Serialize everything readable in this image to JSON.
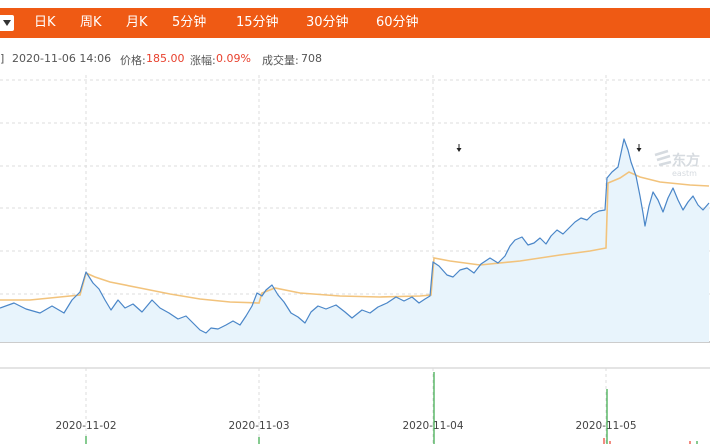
{
  "tabs": [
    "日K",
    "周K",
    "月K",
    "5分钟",
    "15分钟",
    "30分钟",
    "60分钟"
  ],
  "info": {
    "edge_mark": "]",
    "datetime": "2020-11-06 14:06",
    "price_label": "价格:",
    "price_value": "185.00",
    "change_label": "涨幅:",
    "change_value": "0.09%",
    "volume_label": "成交量:",
    "volume_value": "708"
  },
  "watermark": {
    "cn": "东方",
    "en": "eastm"
  },
  "colors": {
    "tabbar": "#ef5a14",
    "price_line": "#4a86c8",
    "avg_line": "#f2c37c",
    "area_fill": "#e8f4fc",
    "up_bar": "#e84030",
    "down_bar": "#35a845",
    "grid": "#dcdcdc"
  },
  "chart_data": {
    "type": "line",
    "x_tick_labels": [
      "2020-11-02",
      "2020-11-03",
      "2020-11-04",
      "2020-11-05"
    ],
    "grid": true,
    "series": [
      {
        "role": "price",
        "points": [
          [
            0,
            308
          ],
          [
            14,
            303
          ],
          [
            26,
            309
          ],
          [
            40,
            313
          ],
          [
            52,
            306
          ],
          [
            64,
            313
          ],
          [
            72,
            300
          ],
          [
            80,
            292
          ],
          [
            86,
            272
          ],
          [
            93,
            283
          ],
          [
            99,
            289
          ],
          [
            105,
            300
          ],
          [
            111,
            310
          ],
          [
            118,
            300
          ],
          [
            125,
            308
          ],
          [
            133,
            304
          ],
          [
            142,
            312
          ],
          [
            152,
            300
          ],
          [
            160,
            308
          ],
          [
            169,
            313
          ],
          [
            178,
            319
          ],
          [
            186,
            316
          ],
          [
            193,
            323
          ],
          [
            200,
            330
          ],
          [
            206,
            333
          ],
          [
            211,
            328
          ],
          [
            218,
            329
          ],
          [
            226,
            325
          ],
          [
            233,
            321
          ],
          [
            240,
            325
          ],
          [
            246,
            316
          ],
          [
            252,
            306
          ],
          [
            257,
            293
          ],
          [
            262,
            296
          ],
          [
            266,
            290
          ],
          [
            272,
            285
          ],
          [
            278,
            295
          ],
          [
            284,
            302
          ],
          [
            291,
            313
          ],
          [
            298,
            317
          ],
          [
            305,
            323
          ],
          [
            311,
            312
          ],
          [
            318,
            306
          ],
          [
            326,
            309
          ],
          [
            336,
            305
          ],
          [
            345,
            312
          ],
          [
            352,
            318
          ],
          [
            362,
            310
          ],
          [
            370,
            313
          ],
          [
            378,
            307
          ],
          [
            387,
            303
          ],
          [
            396,
            297
          ],
          [
            404,
            301
          ],
          [
            412,
            297
          ],
          [
            419,
            303
          ],
          [
            425,
            299
          ],
          [
            430,
            296
          ],
          [
            433,
            262
          ],
          [
            439,
            266
          ],
          [
            447,
            275
          ],
          [
            453,
            277
          ],
          [
            460,
            270
          ],
          [
            467,
            268
          ],
          [
            474,
            273
          ],
          [
            481,
            264
          ],
          [
            490,
            258
          ],
          [
            498,
            263
          ],
          [
            505,
            256
          ],
          [
            510,
            246
          ],
          [
            515,
            240
          ],
          [
            522,
            237
          ],
          [
            528,
            245
          ],
          [
            534,
            243
          ],
          [
            540,
            238
          ],
          [
            546,
            244
          ],
          [
            551,
            236
          ],
          [
            557,
            230
          ],
          [
            563,
            234
          ],
          [
            569,
            228
          ],
          [
            575,
            222
          ],
          [
            581,
            218
          ],
          [
            587,
            220
          ],
          [
            593,
            214
          ],
          [
            599,
            211
          ],
          [
            605,
            210
          ],
          [
            607,
            178
          ],
          [
            612,
            172
          ],
          [
            618,
            167
          ],
          [
            624,
            139
          ],
          [
            628,
            150
          ],
          [
            631,
            162
          ],
          [
            636,
            176
          ],
          [
            640,
            196
          ],
          [
            643,
            213
          ],
          [
            645,
            226
          ],
          [
            649,
            206
          ],
          [
            653,
            192
          ],
          [
            658,
            200
          ],
          [
            663,
            212
          ],
          [
            668,
            198
          ],
          [
            673,
            188
          ],
          [
            678,
            200
          ],
          [
            683,
            210
          ],
          [
            688,
            202
          ],
          [
            693,
            196
          ],
          [
            698,
            205
          ],
          [
            703,
            210
          ],
          [
            709,
            203
          ]
        ]
      },
      {
        "role": "average",
        "points": [
          [
            0,
            300
          ],
          [
            30,
            300
          ],
          [
            60,
            297
          ],
          [
            80,
            295
          ],
          [
            86,
            273
          ],
          [
            95,
            277
          ],
          [
            110,
            282
          ],
          [
            140,
            288
          ],
          [
            170,
            294
          ],
          [
            200,
            299
          ],
          [
            230,
            302
          ],
          [
            259,
            303
          ],
          [
            262,
            293
          ],
          [
            275,
            288
          ],
          [
            300,
            293
          ],
          [
            340,
            296
          ],
          [
            380,
            297
          ],
          [
            420,
            296
          ],
          [
            431,
            295
          ],
          [
            434,
            258
          ],
          [
            450,
            261
          ],
          [
            480,
            265
          ],
          [
            520,
            261
          ],
          [
            560,
            255
          ],
          [
            590,
            251
          ],
          [
            606,
            248
          ],
          [
            608,
            183
          ],
          [
            620,
            178
          ],
          [
            629,
            172
          ],
          [
            640,
            177
          ],
          [
            660,
            182
          ],
          [
            690,
            185
          ],
          [
            709,
            186
          ]
        ]
      }
    ],
    "volume_bars": [
      {
        "x": 86,
        "value": 8,
        "direction": "down"
      },
      {
        "x": 259,
        "value": 7,
        "direction": "down"
      },
      {
        "x": 434,
        "value": 72,
        "direction": "down"
      },
      {
        "x": 604,
        "value": 6,
        "direction": "up"
      },
      {
        "x": 607,
        "value": 55,
        "direction": "down"
      },
      {
        "x": 610,
        "value": 3,
        "direction": "up"
      },
      {
        "x": 690,
        "value": 3,
        "direction": "up"
      },
      {
        "x": 697,
        "value": 3,
        "direction": "down"
      }
    ]
  }
}
